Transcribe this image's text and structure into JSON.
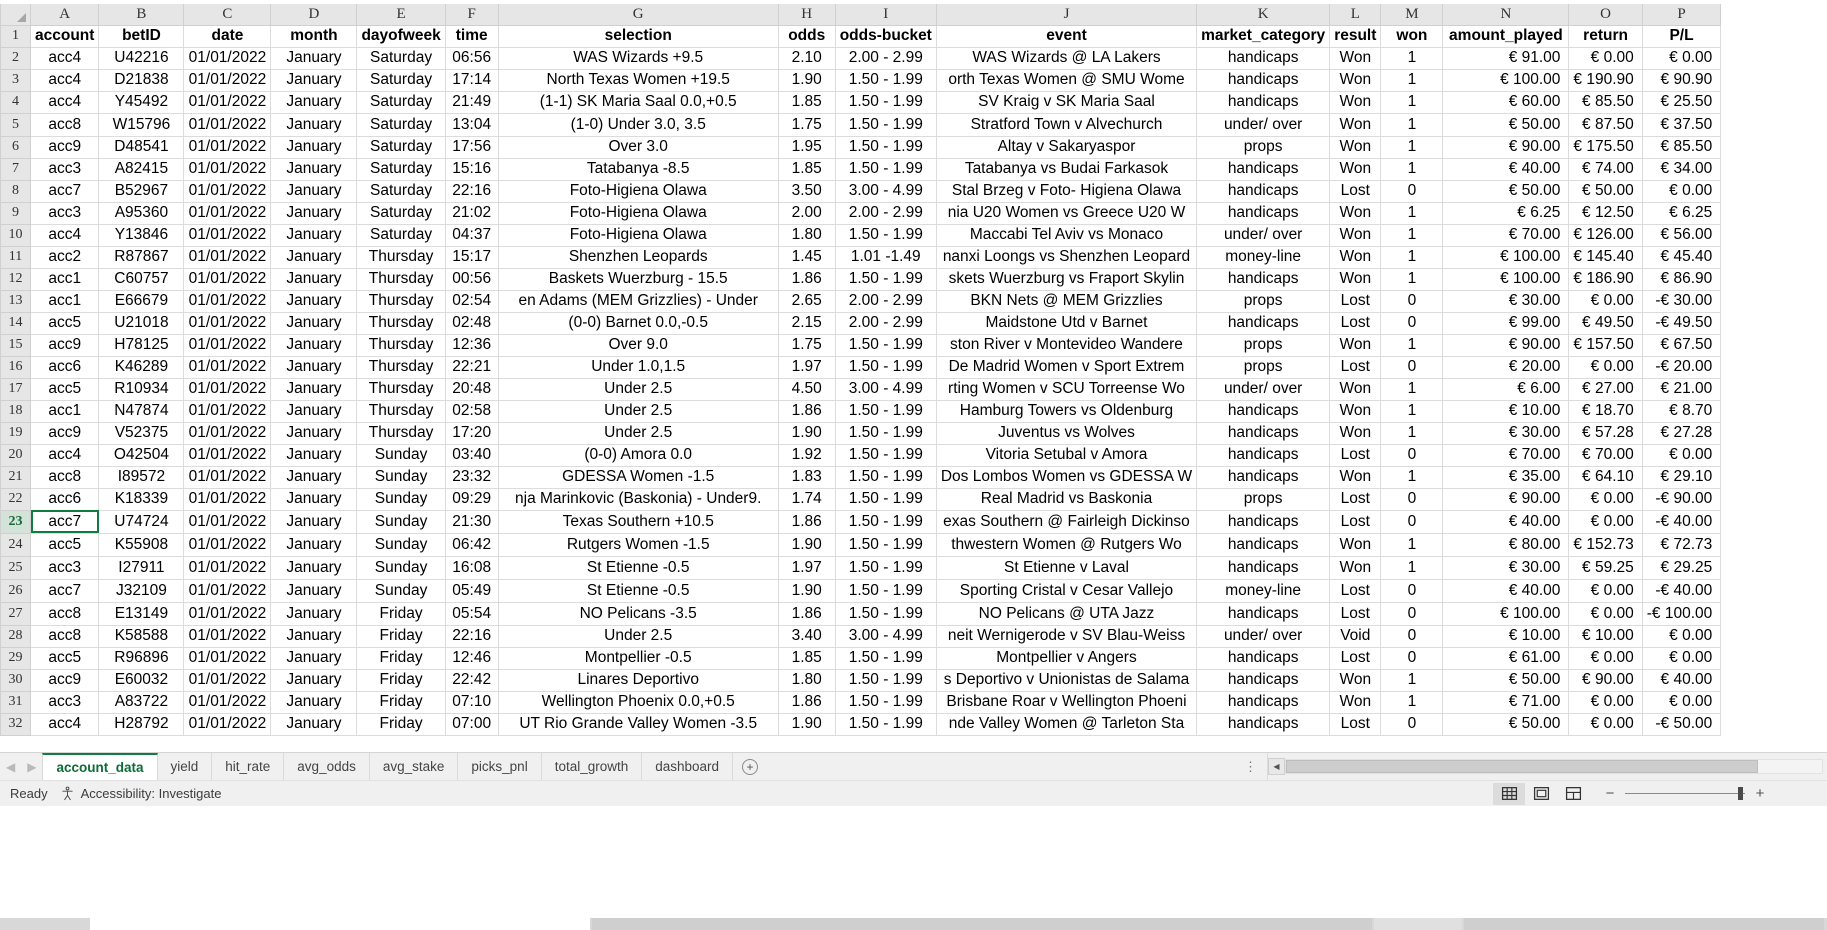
{
  "app": {
    "name": "Microsoft Excel",
    "active_cell": "A23"
  },
  "grid": {
    "corner_icon": "select-all-triangle-icon",
    "column_letters": [
      "A",
      "B",
      "C",
      "D",
      "E",
      "F",
      "G",
      "H",
      "I",
      "J",
      "K",
      "L",
      "M",
      "N",
      "O",
      "P"
    ],
    "row_numbers": [
      "1",
      "2",
      "3",
      "4",
      "5",
      "6",
      "7",
      "8",
      "9",
      "10",
      "11",
      "12",
      "13",
      "14",
      "15",
      "16",
      "17",
      "18",
      "19",
      "20",
      "21",
      "22",
      "23",
      "24",
      "25",
      "26",
      "27",
      "28",
      "29",
      "30",
      "31",
      "32"
    ],
    "selected_row": "23",
    "headers": [
      "account",
      "betID",
      "date",
      "month",
      "dayofweek",
      "time",
      "selection",
      "odds",
      "odds-bucket",
      "event",
      "market_category",
      "result",
      "won",
      "amount_played",
      "return",
      "P/L"
    ],
    "rows": [
      [
        "acc4",
        "U42216",
        "01/01/2022",
        "January",
        "Saturday",
        "06:56",
        "WAS Wizards +9.5",
        "2.10",
        "2.00 - 2.99",
        "WAS Wizards @ LA Lakers",
        "handicaps",
        "Won",
        "1",
        "€ 91.00",
        "€ 0.00",
        "€ 0.00"
      ],
      [
        "acc4",
        "D21838",
        "01/01/2022",
        "January",
        "Saturday",
        "17:14",
        "North Texas Women +19.5",
        "1.90",
        "1.50 - 1.99",
        "orth Texas Women @ SMU Wome",
        "handicaps",
        "Won",
        "1",
        "€ 100.00",
        "€ 190.90",
        "€ 90.90"
      ],
      [
        "acc4",
        "Y45492",
        "01/01/2022",
        "January",
        "Saturday",
        "21:49",
        "(1-1) SK Maria Saal 0.0,+0.5",
        "1.85",
        "1.50 - 1.99",
        "SV Kraig v SK Maria Saal",
        "handicaps",
        "Won",
        "1",
        "€ 60.00",
        "€ 85.50",
        "€ 25.50"
      ],
      [
        "acc8",
        "W15796",
        "01/01/2022",
        "January",
        "Saturday",
        "13:04",
        "(1-0) Under 3.0, 3.5",
        "1.75",
        "1.50 - 1.99",
        "Stratford Town v Alvechurch",
        "under/ over",
        "Won",
        "1",
        "€ 50.00",
        "€ 87.50",
        "€ 37.50"
      ],
      [
        "acc9",
        "D48541",
        "01/01/2022",
        "January",
        "Saturday",
        "17:56",
        "Over 3.0",
        "1.95",
        "1.50 - 1.99",
        "Altay v Sakaryaspor",
        "props",
        "Won",
        "1",
        "€ 90.00",
        "€ 175.50",
        "€ 85.50"
      ],
      [
        "acc3",
        "A82415",
        "01/01/2022",
        "January",
        "Saturday",
        "15:16",
        "Tatabanya -8.5",
        "1.85",
        "1.50 - 1.99",
        "Tatabanya vs Budai Farkasok",
        "handicaps",
        "Won",
        "1",
        "€ 40.00",
        "€ 74.00",
        "€ 34.00"
      ],
      [
        "acc7",
        "B52967",
        "01/01/2022",
        "January",
        "Saturday",
        "22:16",
        "Foto-Higiena Olawa",
        "3.50",
        "3.00 - 4.99",
        "Stal Brzeg v Foto- Higiena Olawa",
        "handicaps",
        "Lost",
        "0",
        "€ 50.00",
        "€ 50.00",
        "€ 0.00"
      ],
      [
        "acc3",
        "A95360",
        "01/01/2022",
        "January",
        "Saturday",
        "21:02",
        "Foto-Higiena Olawa",
        "2.00",
        "2.00 - 2.99",
        "nia U20 Women vs Greece U20 W",
        "handicaps",
        "Won",
        "1",
        "€ 6.25",
        "€ 12.50",
        "€ 6.25"
      ],
      [
        "acc4",
        "Y13846",
        "01/01/2022",
        "January",
        "Saturday",
        "04:37",
        "Foto-Higiena Olawa",
        "1.80",
        "1.50 - 1.99",
        "Maccabi Tel Aviv vs Monaco",
        "under/ over",
        "Won",
        "1",
        "€ 70.00",
        "€ 126.00",
        "€ 56.00"
      ],
      [
        "acc2",
        "R87867",
        "01/01/2022",
        "January",
        "Thursday",
        "15:17",
        "Shenzhen Leopards",
        "1.45",
        "1.01 -1.49",
        "nanxi Loongs vs Shenzhen Leopard",
        "money-line",
        "Won",
        "1",
        "€ 100.00",
        "€ 145.40",
        "€ 45.40"
      ],
      [
        "acc1",
        "C60757",
        "01/01/2022",
        "January",
        "Thursday",
        "00:56",
        "Baskets Wuerzburg - 15.5",
        "1.86",
        "1.50 - 1.99",
        "skets Wuerzburg vs Fraport Skylin",
        "handicaps",
        "Won",
        "1",
        "€ 100.00",
        "€ 186.90",
        "€ 86.90"
      ],
      [
        "acc1",
        "E66679",
        "01/01/2022",
        "January",
        "Thursday",
        "02:54",
        "en Adams (MEM Grizzlies) - Under",
        "2.65",
        "2.00 - 2.99",
        "BKN Nets @ MEM Grizzlies",
        "props",
        "Lost",
        "0",
        "€ 30.00",
        "€ 0.00",
        "-€ 30.00"
      ],
      [
        "acc5",
        "U21018",
        "01/01/2022",
        "January",
        "Thursday",
        "02:48",
        "(0-0) Barnet 0.0,-0.5",
        "2.15",
        "2.00 - 2.99",
        "Maidstone Utd v Barnet",
        "handicaps",
        "Lost",
        "0",
        "€ 99.00",
        "€ 49.50",
        "-€ 49.50"
      ],
      [
        "acc9",
        "H78125",
        "01/01/2022",
        "January",
        "Thursday",
        "12:36",
        "Over 9.0",
        "1.75",
        "1.50 - 1.99",
        "ston River v Montevideo Wandere",
        "props",
        "Won",
        "1",
        "€ 90.00",
        "€ 157.50",
        "€ 67.50"
      ],
      [
        "acc6",
        "K46289",
        "01/01/2022",
        "January",
        "Thursday",
        "22:21",
        "Under 1.0,1.5",
        "1.97",
        "1.50 - 1.99",
        "De Madrid Women v Sport Extrem",
        "props",
        "Lost",
        "0",
        "€ 20.00",
        "€ 0.00",
        "-€ 20.00"
      ],
      [
        "acc5",
        "R10934",
        "01/01/2022",
        "January",
        "Thursday",
        "20:48",
        "Under 2.5",
        "4.50",
        "3.00 - 4.99",
        "rting Women v SCU Torreense Wo",
        "under/ over",
        "Won",
        "1",
        "€ 6.00",
        "€ 27.00",
        "€ 21.00"
      ],
      [
        "acc1",
        "N47874",
        "01/01/2022",
        "January",
        "Thursday",
        "02:58",
        "Under 2.5",
        "1.86",
        "1.50 - 1.99",
        "Hamburg Towers vs Oldenburg",
        "handicaps",
        "Won",
        "1",
        "€ 10.00",
        "€ 18.70",
        "€ 8.70"
      ],
      [
        "acc9",
        "V52375",
        "01/01/2022",
        "January",
        "Thursday",
        "17:20",
        "Under 2.5",
        "1.90",
        "1.50 - 1.99",
        "Juventus vs Wolves",
        "handicaps",
        "Won",
        "1",
        "€ 30.00",
        "€ 57.28",
        "€ 27.28"
      ],
      [
        "acc4",
        "O42504",
        "01/01/2022",
        "January",
        "Sunday",
        "03:40",
        "(0-0) Amora 0.0",
        "1.92",
        "1.50 - 1.99",
        "Vitoria Setubal v Amora",
        "handicaps",
        "Lost",
        "0",
        "€ 70.00",
        "€ 70.00",
        "€ 0.00"
      ],
      [
        "acc8",
        "I89572",
        "01/01/2022",
        "January",
        "Sunday",
        "23:32",
        "GDESSA Women -1.5",
        "1.83",
        "1.50 - 1.99",
        "Dos Lombos Women vs GDESSA W",
        "handicaps",
        "Won",
        "1",
        "€ 35.00",
        "€ 64.10",
        "€ 29.10"
      ],
      [
        "acc6",
        "K18339",
        "01/01/2022",
        "January",
        "Sunday",
        "09:29",
        "nja Marinkovic (Baskonia) - Under9.",
        "1.74",
        "1.50 - 1.99",
        "Real Madrid vs Baskonia",
        "props",
        "Lost",
        "0",
        "€ 90.00",
        "€ 0.00",
        "-€ 90.00"
      ],
      [
        "acc7",
        "U74724",
        "01/01/2022",
        "January",
        "Sunday",
        "21:30",
        "Texas Southern +10.5",
        "1.86",
        "1.50 - 1.99",
        "exas Southern @ Fairleigh Dickinso",
        "handicaps",
        "Lost",
        "0",
        "€ 40.00",
        "€ 0.00",
        "-€ 40.00"
      ],
      [
        "acc5",
        "K55908",
        "01/01/2022",
        "January",
        "Sunday",
        "06:42",
        "Rutgers Women -1.5",
        "1.90",
        "1.50 - 1.99",
        "thwestern Women @ Rutgers Wo",
        "handicaps",
        "Won",
        "1",
        "€ 80.00",
        "€ 152.73",
        "€ 72.73"
      ],
      [
        "acc3",
        "I27911",
        "01/01/2022",
        "January",
        "Sunday",
        "16:08",
        "St Etienne -0.5",
        "1.97",
        "1.50 - 1.99",
        "St Etienne v Laval",
        "handicaps",
        "Won",
        "1",
        "€ 30.00",
        "€ 59.25",
        "€ 29.25"
      ],
      [
        "acc7",
        "J32109",
        "01/01/2022",
        "January",
        "Sunday",
        "05:49",
        "St Etienne -0.5",
        "1.90",
        "1.50 - 1.99",
        "Sporting Cristal v Cesar Vallejo",
        "money-line",
        "Lost",
        "0",
        "€ 40.00",
        "€ 0.00",
        "-€ 40.00"
      ],
      [
        "acc8",
        "E13149",
        "01/01/2022",
        "January",
        "Friday",
        "05:54",
        "NO Pelicans -3.5",
        "1.86",
        "1.50 - 1.99",
        "NO Pelicans @ UTA Jazz",
        "handicaps",
        "Lost",
        "0",
        "€ 100.00",
        "€ 0.00",
        "-€ 100.00"
      ],
      [
        "acc8",
        "K58588",
        "01/01/2022",
        "January",
        "Friday",
        "22:16",
        "Under 2.5",
        "3.40",
        "3.00 - 4.99",
        "neit Wernigerode v SV Blau-Weiss",
        "under/ over",
        "Void",
        "0",
        "€ 10.00",
        "€ 10.00",
        "€ 0.00"
      ],
      [
        "acc5",
        "R96896",
        "01/01/2022",
        "January",
        "Friday",
        "12:46",
        "Montpellier -0.5",
        "1.85",
        "1.50 - 1.99",
        "Montpellier v Angers",
        "handicaps",
        "Lost",
        "0",
        "€ 61.00",
        "€ 0.00",
        "€ 0.00"
      ],
      [
        "acc9",
        "E60032",
        "01/01/2022",
        "January",
        "Friday",
        "22:42",
        "Linares Deportivo",
        "1.80",
        "1.50 - 1.99",
        "s Deportivo v Unionistas de Salama",
        "handicaps",
        "Won",
        "1",
        "€ 50.00",
        "€ 90.00",
        "€ 40.00"
      ],
      [
        "acc3",
        "A83722",
        "01/01/2022",
        "January",
        "Friday",
        "07:10",
        "Wellington Phoenix 0.0,+0.5",
        "1.86",
        "1.50 - 1.99",
        "Brisbane Roar v Wellington Phoeni",
        "handicaps",
        "Won",
        "1",
        "€ 71.00",
        "€ 0.00",
        "€ 0.00"
      ],
      [
        "acc4",
        "H28792",
        "01/01/2022",
        "January",
        "Friday",
        "07:00",
        "UT Rio Grande Valley Women -3.5",
        "1.90",
        "1.50 - 1.99",
        "nde Valley Women @ Tarleton Sta",
        "handicaps",
        "Lost",
        "0",
        "€ 50.00",
        "€ 0.00",
        "-€ 50.00"
      ]
    ]
  },
  "sheet_tabs": {
    "prev_icon": "chevron-left-icon",
    "next_icon": "chevron-right-icon",
    "add_icon": "add-sheet-icon",
    "add_label": "+",
    "overflow_label": "⋮",
    "items": [
      {
        "label": "account_data",
        "active": true
      },
      {
        "label": "yield",
        "active": false
      },
      {
        "label": "hit_rate",
        "active": false
      },
      {
        "label": "avg_odds",
        "active": false
      },
      {
        "label": "avg_stake",
        "active": false
      },
      {
        "label": "picks_pnl",
        "active": false
      },
      {
        "label": "total_growth",
        "active": false
      },
      {
        "label": "dashboard",
        "active": false
      }
    ]
  },
  "scrollbar": {
    "left_arrow": "◀",
    "right_arrow": "▶"
  },
  "status_bar": {
    "ready_label": "Ready",
    "accessibility_label": "Accessibility: Investigate",
    "accessibility_icon": "accessibility-icon",
    "views": [
      {
        "name": "normal-view-button",
        "icon": "grid-view-icon",
        "selected": true
      },
      {
        "name": "page-layout-view-button",
        "icon": "page-layout-icon",
        "selected": false
      },
      {
        "name": "page-break-view-button",
        "icon": "page-break-icon",
        "selected": false
      }
    ],
    "zoom_out_label": "−",
    "zoom_in_label": "+",
    "zoom_level": ""
  }
}
